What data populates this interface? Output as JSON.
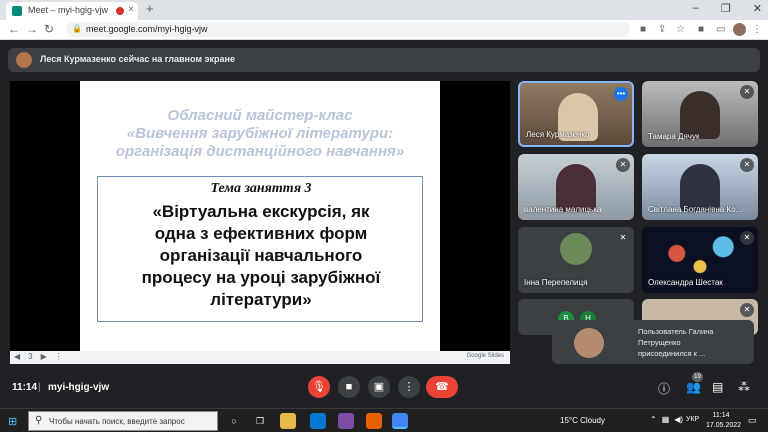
{
  "browser": {
    "tab_title": "Meet – myi-hgig-vjw",
    "new_tab": "+",
    "tab_close": "×",
    "url": "meet.google.com/myi-hgig-vjw",
    "window_controls": [
      "–",
      "❐",
      "✕"
    ]
  },
  "meet": {
    "presenting_banner": "Леся Курмазенко сейчас на главном экране",
    "slide": {
      "heading_lines": [
        "Обласний майстер-клас",
        "«Вивчення зарубіжної літератури:",
        "організація дистанційного навчання»"
      ],
      "topic": "Тема заняття 3",
      "body_lines": [
        "«Віртуальна екскурсія, як",
        "одна з ефективних форм",
        "організації навчального",
        "процесу на уроці  зарубіжної",
        "літератури»"
      ],
      "page_number": "3",
      "brand": "Google Slides"
    },
    "participants": [
      {
        "name": "Леся Курмазенко"
      },
      {
        "name": "Тамара Дячук"
      },
      {
        "name": "валентина малицька"
      },
      {
        "name": "Світлана Богданівна Ко..."
      },
      {
        "name": "Інна Перепелиця"
      },
      {
        "name": "Олександра Шестак"
      },
      {
        "name": "",
        "initials": [
          "В",
          "Н"
        ]
      },
      {
        "name": ""
      }
    ],
    "toast_lines": [
      "Пользователь Галина",
      "Петрущенко",
      "присоединился к ..."
    ],
    "time": "11:14",
    "separator": "|",
    "meeting_code": "myi-hgig-vjw",
    "people_count": "19",
    "accent_red": "#ea4335",
    "accent_blue": "#1a73e8"
  },
  "taskbar": {
    "search_placeholder": "Чтобы начать поиск, введите запрос",
    "weather": "15°C  Cloudy",
    "language": "УКР",
    "clock_time": "11:14",
    "clock_date": "17.05.2022"
  }
}
